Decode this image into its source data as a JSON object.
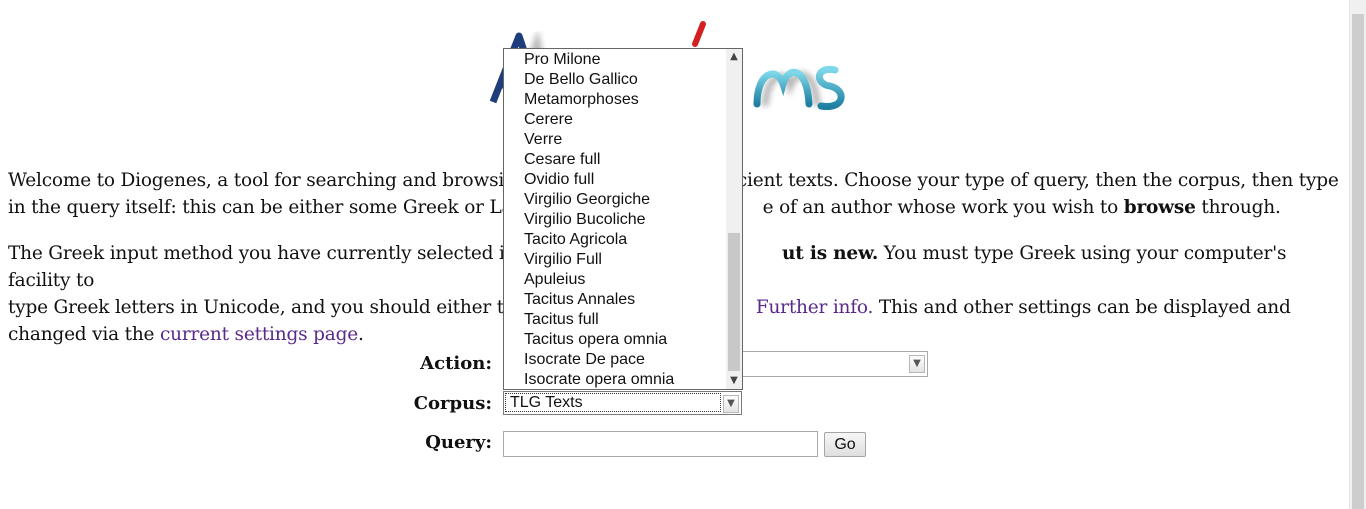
{
  "intro": {
    "p1_part1": "Welcome to Diogenes, a tool for searching and browsin",
    "p1_part2": "cient texts. Choose your type of query, then the corpus, then type",
    "p1_part3": "in the query itself: this can be either some Greek or Lat",
    "p1_part4": "e of an author whose work you wish to ",
    "p1_bold": "browse",
    "p1_end": " through.",
    "p2_part1": "The Greek input method you have currently selected is:",
    "p2_bold": "ut is new.",
    "p2_part2": " You must type Greek using your computer's facility to",
    "p2_part3": "type Greek letters in Unicode, and you should either typ",
    "p2_link_further": "Further info.",
    "p2_part4": " This and other settings can be displayed and",
    "p2_part5": "changed via the ",
    "p2_link_settings": "current settings page",
    "p2_end": "."
  },
  "form": {
    "action_label": "Action:",
    "corpus_label": "Corpus:",
    "query_label": "Query:",
    "corpus_value": "TLG Texts",
    "action_value": "",
    "query_value": "",
    "go_label": "Go"
  },
  "dropdown": {
    "items": [
      "Pro Milone",
      "De Bello Gallico",
      "Metamorphoses",
      "Cerere",
      "Verre",
      "Cesare full",
      "Ovidio full",
      "Virgilio Georgiche",
      "Virgilio Bucoliche",
      "Tacito Agricola",
      "Virgilio Full",
      "Apuleius",
      "Tacitus Annales",
      "Tacitus full",
      "Tacitus opera omnia",
      "Isocrate De pace",
      "Isocrate opera omnia"
    ]
  },
  "icons": {
    "dropdown_arrow": "chevron-down-icon",
    "scroll_up": "chevron-up-icon",
    "scroll_down": "chevron-down-icon"
  },
  "colors": {
    "link": "#5a2a8a",
    "logo_blue_dark": "#1f3d7a",
    "logo_teal": "#2aa6c4",
    "logo_red": "#d42020"
  }
}
